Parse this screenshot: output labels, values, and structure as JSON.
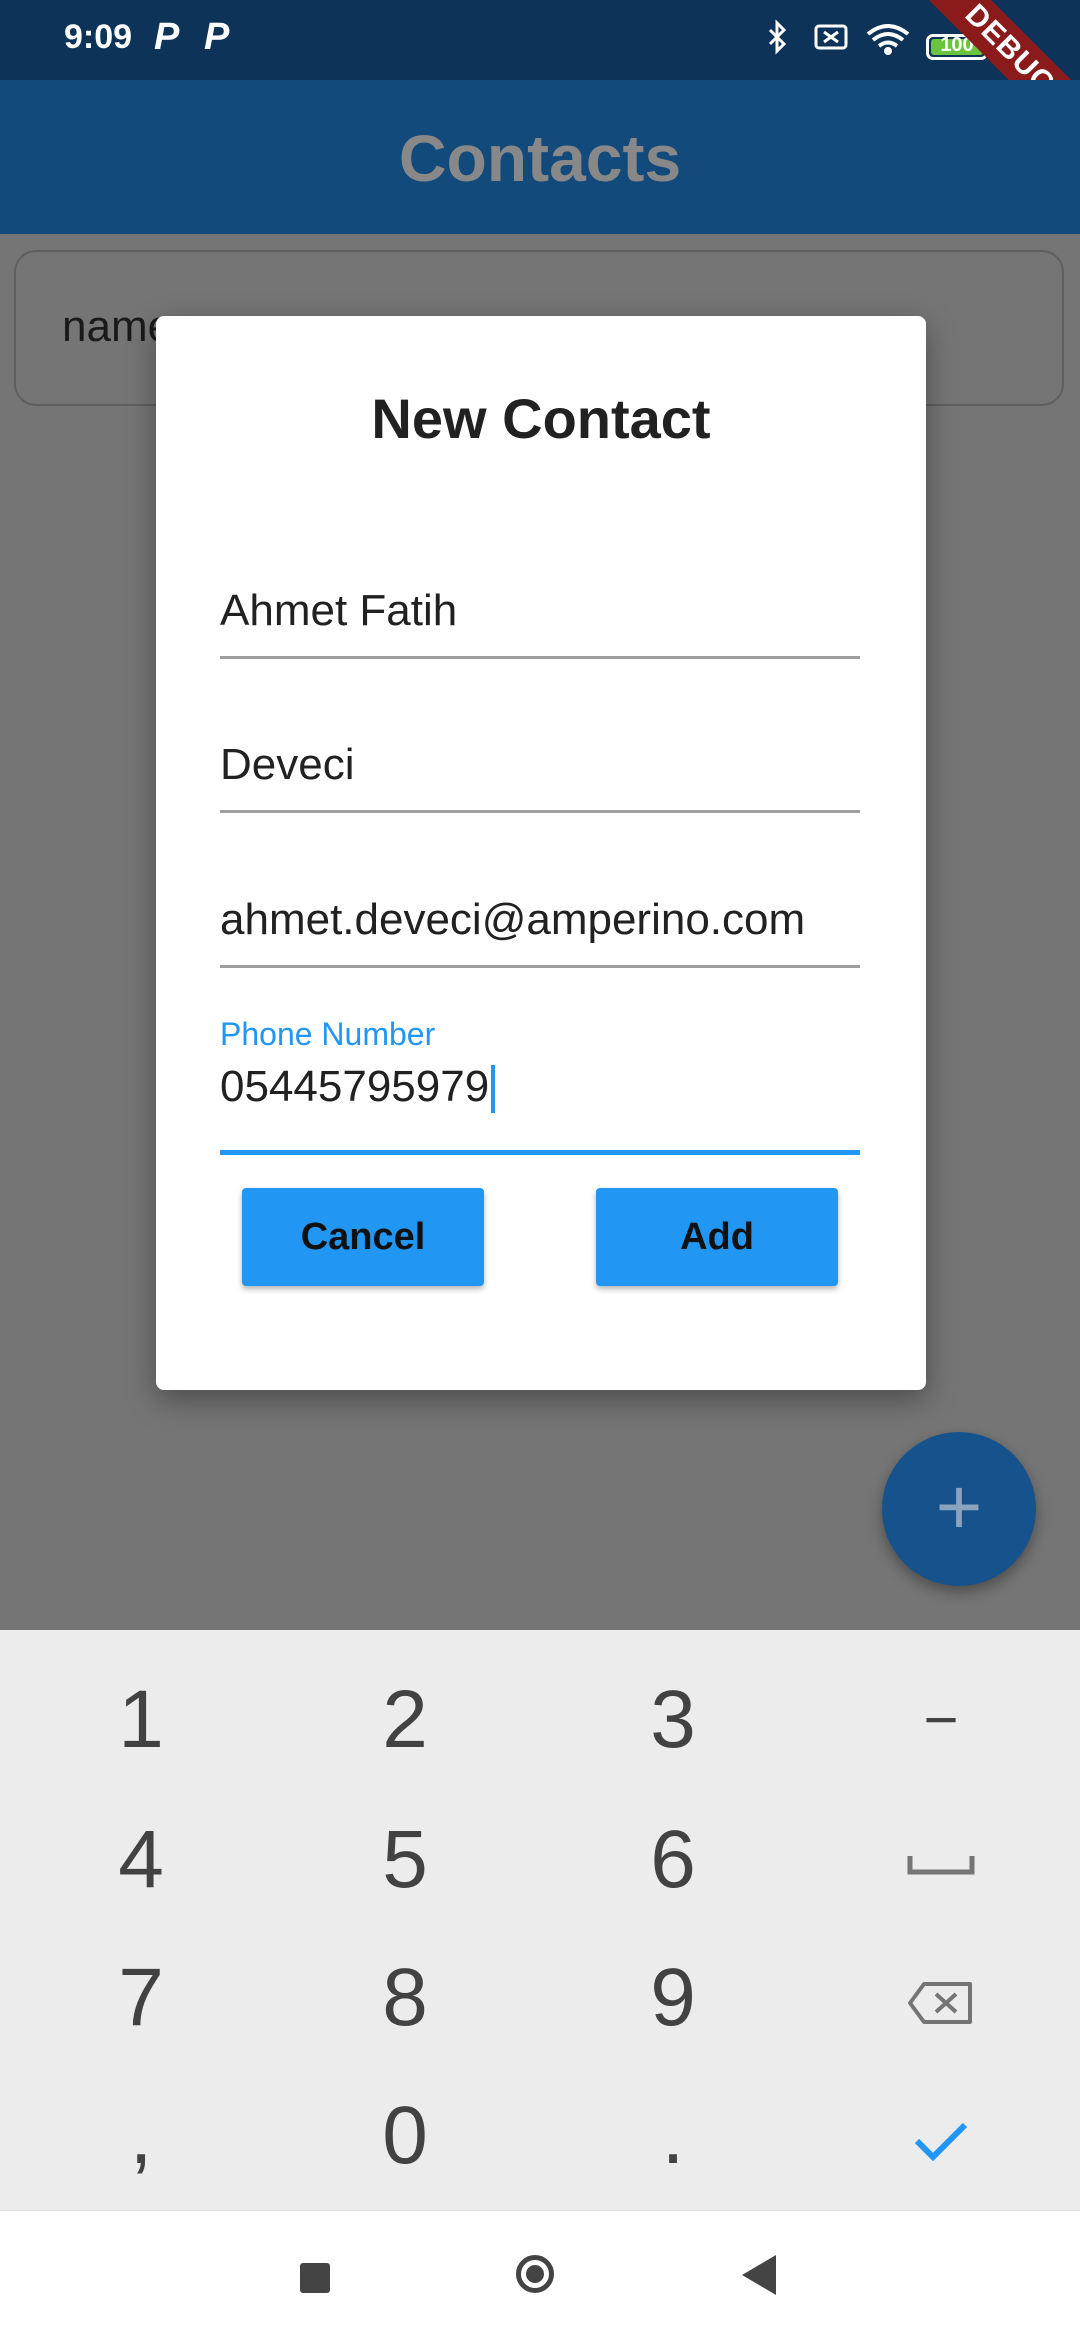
{
  "status_bar": {
    "time": "9:09",
    "notif_icons": [
      "P",
      "P"
    ],
    "battery_level": "100",
    "debug_banner": "DEBUG"
  },
  "app_bar": {
    "title": "Contacts"
  },
  "search": {
    "label": "name"
  },
  "dialog": {
    "title": "New Contact",
    "first_name_value": "Ahmet Fatih",
    "last_name_value": "Deveci",
    "email_value": "ahmet.deveci@amperino.com",
    "phone_label": "Phone Number",
    "phone_value": "05445795979",
    "cancel_label": "Cancel",
    "add_label": "Add"
  },
  "fab": {
    "icon": "plus-icon",
    "glyph": "+"
  },
  "keyboard": {
    "rows": [
      [
        "1",
        "2",
        "3",
        "−"
      ],
      [
        "4",
        "5",
        "6",
        "space"
      ],
      [
        "7",
        "8",
        "9",
        "backspace"
      ],
      [
        ",",
        "0",
        ".",
        "done"
      ]
    ],
    "key_1": "1",
    "key_2": "2",
    "key_3": "3",
    "key_minus": "−",
    "key_4": "4",
    "key_5": "5",
    "key_6": "6",
    "key_7": "7",
    "key_8": "8",
    "key_9": "9",
    "key_comma": ",",
    "key_0": "0",
    "key_period": "."
  },
  "colors": {
    "accent": "#2196f3",
    "app_bar": "#134a7c",
    "status_bar": "#0d3458",
    "scrim": "#757575",
    "debug": "#8b1a1a"
  }
}
